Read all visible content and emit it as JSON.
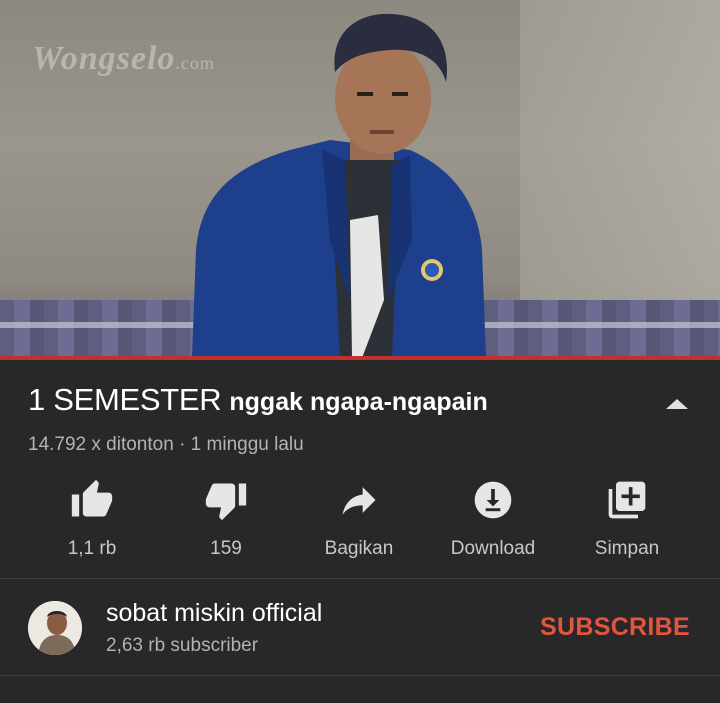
{
  "video": {
    "watermark": "Wongselo",
    "watermark_suffix": ".com"
  },
  "title": {
    "part1": "1  SEMESTER",
    "part2": "nggak ngapa-ngapain"
  },
  "meta": "14.792 x ditonton · 1 minggu lalu",
  "actions": [
    {
      "label": "1,1 rb",
      "icon": "thumbs-up-icon"
    },
    {
      "label": "159",
      "icon": "thumbs-down-icon"
    },
    {
      "label": "Bagikan",
      "icon": "share-icon"
    },
    {
      "label": "Download",
      "icon": "download-icon"
    },
    {
      "label": "Simpan",
      "icon": "add-to-playlist-icon"
    }
  ],
  "channel": {
    "name": "sobat miskin official",
    "subscribers": "2,63 rb subscriber",
    "subscribe_label": "SUBSCRIBE"
  },
  "colors": {
    "background": "#282828",
    "progress": "#c4302b",
    "subscribe": "#e4553f"
  }
}
